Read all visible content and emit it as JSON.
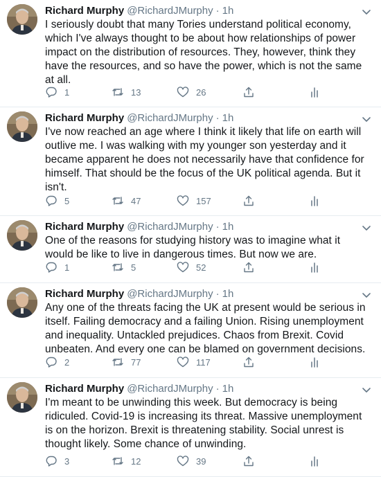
{
  "tweets": [
    {
      "name": "Richard Murphy",
      "handle": "@RichardJMurphy",
      "separator": "·",
      "time": "1h",
      "text": "I seriously doubt that many Tories understand political economy, which I've always thought to be about how relationships of power impact on the distribution of resources. They, however, think they have the resources, and so have the power, which is not the same at all.",
      "replies": "1",
      "retweets": "13",
      "likes": "26"
    },
    {
      "name": "Richard Murphy",
      "handle": "@RichardJMurphy",
      "separator": "·",
      "time": "1h",
      "text": "I've now reached an age where I think it likely that life on earth will outlive me. I was walking with my younger son yesterday and it became apparent he does not necessarily have that confidence for himself. That should be the focus of the UK political agenda. But it isn't.",
      "replies": "5",
      "retweets": "47",
      "likes": "157"
    },
    {
      "name": "Richard Murphy",
      "handle": "@RichardJMurphy",
      "separator": "·",
      "time": "1h",
      "text": "One of the reasons for studying history was to imagine what it would be like to live in dangerous times. But now we are.",
      "replies": "1",
      "retweets": "5",
      "likes": "52"
    },
    {
      "name": "Richard Murphy",
      "handle": "@RichardJMurphy",
      "separator": "·",
      "time": "1h",
      "text": "Any one of the threats facing the UK at present would be serious in itself. Failing democracy and a failing Union. Rising unemployment and inequality. Untackled prejudices. Chaos from Brexit. Covid unbeaten. And every one can be blamed on government decisions.",
      "replies": "2",
      "retweets": "77",
      "likes": "117"
    },
    {
      "name": "Richard Murphy",
      "handle": "@RichardJMurphy",
      "separator": "·",
      "time": "1h",
      "text": "I'm meant to be unwinding this week. But democracy is being ridiculed. Covid-19 is increasing its threat. Massive unemployment is on the horizon. Brexit is threatening stability. Social unrest is thought likely. Some chance of unwinding.",
      "replies": "3",
      "retweets": "12",
      "likes": "39"
    }
  ],
  "icons": {
    "avatar": "avatar",
    "more": "chevron-down-icon",
    "reply": "reply-icon",
    "retweet": "retweet-icon",
    "like": "heart-icon",
    "share": "share-icon",
    "analytics": "analytics-icon"
  },
  "colors": {
    "text": "#14171a",
    "secondary": "#657786",
    "divider": "#e6ecf0"
  }
}
